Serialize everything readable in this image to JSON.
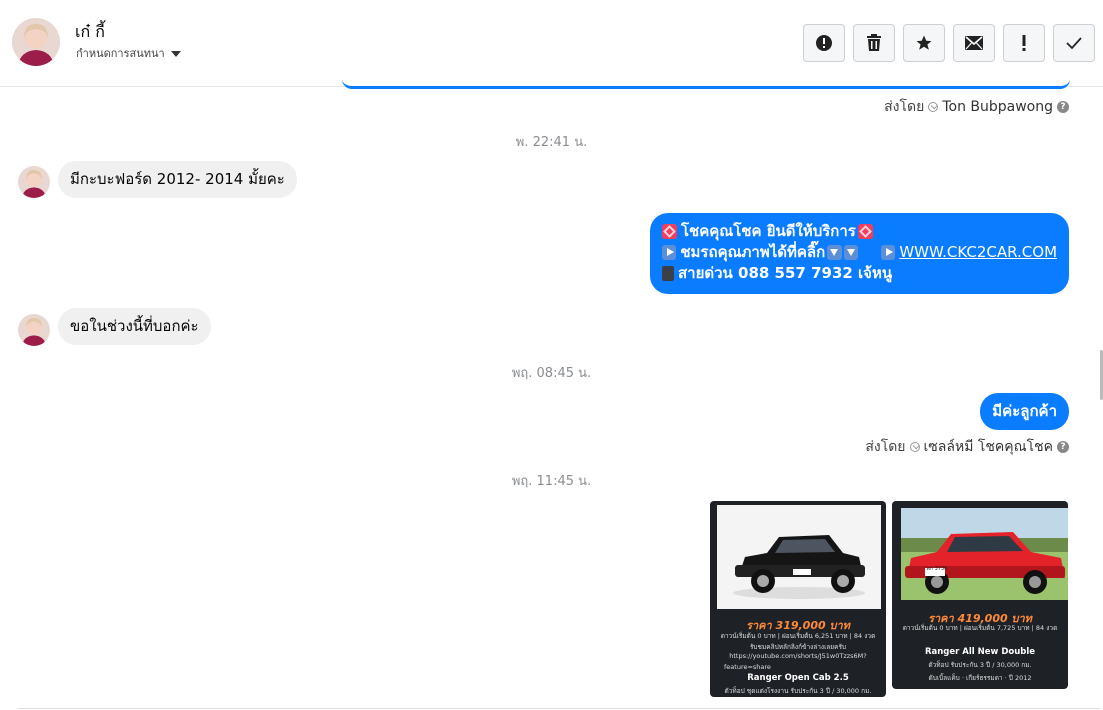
{
  "header": {
    "contact_name": "เก๋ กี้",
    "conversation_settings": "กำหนดการสนทนา",
    "toolbar": [
      {
        "name": "alert-circle-icon"
      },
      {
        "name": "trash-icon"
      },
      {
        "name": "star-icon"
      },
      {
        "name": "mail-icon"
      },
      {
        "name": "exclamation-icon"
      },
      {
        "name": "check-icon"
      }
    ]
  },
  "messages": {
    "sent_by_1": {
      "prefix": "ส่งโดย",
      "name": "Ton Bubpawong"
    },
    "timestamp_1": "พ. 22:41 น.",
    "incoming_1": "มีกะบะฟอร์ด 2012- 2014 มั้ยคะ",
    "outgoing_1": {
      "line1": "โชคคุณโชค ยินดีให้บริการ",
      "line2": "ชมรถคุณภาพได้ที่คลิ๊ก",
      "link": "WWW.CKC2CAR.COM",
      "line3": "สายด่วน 088 557 7932 เจ้หนู"
    },
    "incoming_2": "ขอในช่วงนี้ที่บอกค่ะ",
    "timestamp_2": "พฤ. 08:45 น.",
    "outgoing_2": "มีค่ะลูกค้า",
    "sent_by_2": {
      "prefix": "ส่งโดย",
      "name": "เซลล์หมี โชคคุณโชค"
    },
    "timestamp_3": "พฤ. 11:45 น."
  },
  "attachments": [
    {
      "price": "ราคา 319,000 บาท",
      "terms": "ดาวน์เริ่มต้น 0 บาท | ผ่อนเริ่มต้น 6,251 บาท | 84 งวด",
      "clip_note": "รับชมคลิปหลักลิงก์ข้างล่างเลยครับ",
      "url": "https://youtube.com/shorts/J51w0Tzzs6M?",
      "feature": "feature=share",
      "model": "Ranger Open Cab 2.5",
      "warranty": "ตัวท็อป ชุดแต่งโรงงาน รับประกัน 3 ปี / 30,000 กม."
    },
    {
      "price": "ราคา 419,000 บาท",
      "terms": "ดาวน์เริ่มต้น 0 บาท | ผ่อนเริ่มต้น 7,725 บาท | 84 งวด",
      "model": "Ranger All New Double",
      "warranty": "ตัวท็อป รับประกัน 3 ปี / 30,000 กม.",
      "extra": "ดับเบิ้ลแค็บ  ·  เกียร์ธรรมดา  ·  ปี 2012",
      "plate": "ดก 3736"
    }
  ],
  "colors": {
    "accent": "#0a7cff",
    "incoming_bubble": "#f0f0f0",
    "price_orange": "#ff8a3a"
  }
}
